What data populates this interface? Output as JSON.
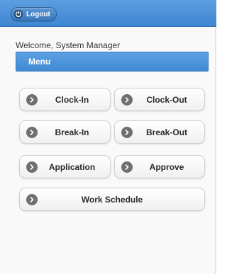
{
  "header": {
    "logout_label": "Logout"
  },
  "welcome_text": "Welcome, System Manager",
  "menu": {
    "title": "Menu",
    "buttons": {
      "clock_in": "Clock-In",
      "clock_out": "Clock-Out",
      "break_in": "Break-In",
      "break_out": "Break-Out",
      "application": "Application",
      "approve": "Approve",
      "work_schedule": "Work Schedule"
    }
  },
  "icons": {
    "logout": "power-icon",
    "button": "chevron-right-icon"
  },
  "colors": {
    "header": "#4a90d9",
    "menu_bar": "#4a8fd8",
    "button_icon": "#6f6f6f"
  }
}
